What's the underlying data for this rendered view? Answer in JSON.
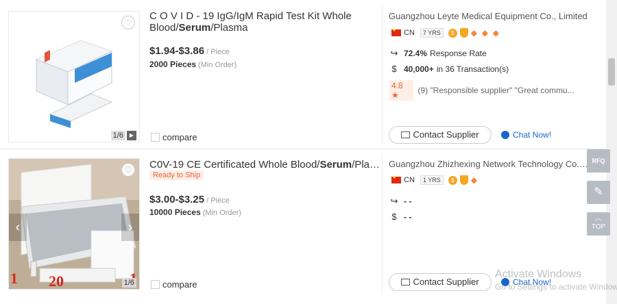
{
  "products": [
    {
      "title_plain": "C O V I D - 19 IgG/IgM Rapid Test Kit Whole Blood/",
      "title_bold": "Serum",
      "title_tail": "/Plasma",
      "price": "$1.94-$3.86",
      "price_unit": "/ Piece",
      "moq": "2000 Pieces",
      "moq_label": "(Min Order)",
      "compare_label": "compare",
      "image_pager": "1/6",
      "supplier_name": "Guangzhou Leyte Medical Equipment Co., Limited",
      "country": "CN",
      "years": "7 YRS",
      "response_rate": "72.4%",
      "response_label": "Response Rate",
      "transactions_amount": "40,000+",
      "transactions_label": "in 36 Transaction(s)",
      "rating": "4.8",
      "reviews": "(9) \"Responsible supplier\"  \"Great commu...",
      "contact_label": "Contact Supplier",
      "chat_label": "Chat Now!"
    },
    {
      "title_plain": "C0V-19 CE Certificated Whole Blood/",
      "title_bold": "Serum",
      "title_tail": "/Plasm...",
      "badge": "Ready to Ship",
      "price": "$3.00-$3.25",
      "price_unit": "/ Piece",
      "moq": "10000 Pieces",
      "moq_label": "(Min Order)",
      "compare_label": "compare",
      "image_pager": "1/6",
      "image_numbers": [
        "1",
        "20",
        "1"
      ],
      "supplier_name": "Guangzhou Zhizhexing Network Technology Co., L...",
      "country": "CN",
      "years": "1 YRS",
      "response_rate": "- -",
      "transactions_amount": "- -",
      "contact_label": "Contact Supplier",
      "chat_label": "Chat Now!"
    }
  ],
  "side_tools": {
    "rfq": "RFQ",
    "top": "TOP"
  },
  "watermark": {
    "line1": "Activate Windows",
    "line2": "Go to Settings to activate Windows."
  },
  "colors": {
    "accent_orange": "#e8663a",
    "link_blue": "#1a66c8",
    "flag_red": "#de2910"
  }
}
